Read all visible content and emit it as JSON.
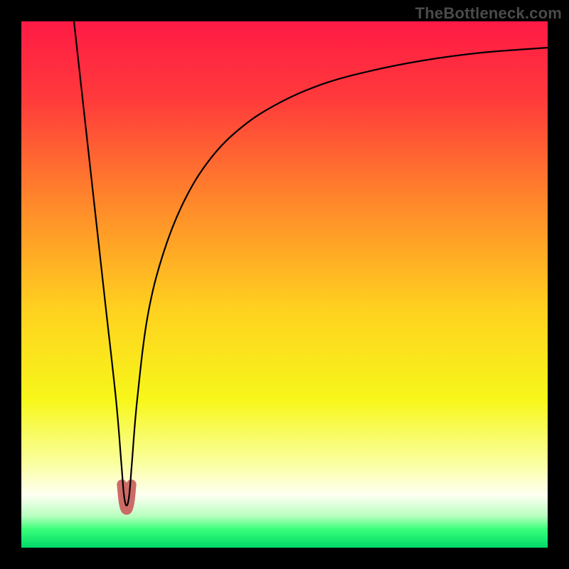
{
  "watermark": "TheBottleneck.com",
  "chart_data": {
    "type": "line",
    "title": "",
    "xlabel": "",
    "ylabel": "",
    "xlim": [
      0,
      100
    ],
    "ylim": [
      0,
      100
    ],
    "grid": false,
    "legend": false,
    "gradient_stops": [
      {
        "offset": 0.0,
        "color": "#ff1a45"
      },
      {
        "offset": 0.15,
        "color": "#ff3b3b"
      },
      {
        "offset": 0.35,
        "color": "#ff8a2a"
      },
      {
        "offset": 0.55,
        "color": "#ffd21f"
      },
      {
        "offset": 0.72,
        "color": "#f7f71a"
      },
      {
        "offset": 0.84,
        "color": "#faffa0"
      },
      {
        "offset": 0.9,
        "color": "#fefff2"
      },
      {
        "offset": 0.94,
        "color": "#b8ffc0"
      },
      {
        "offset": 0.965,
        "color": "#3aff7a"
      },
      {
        "offset": 1.0,
        "color": "#00d968"
      }
    ],
    "series": [
      {
        "name": "bottleneck-curve",
        "color": "#000000",
        "x": [
          10,
          12,
          14,
          16,
          18,
          19,
          19.5,
          20,
          20.5,
          21,
          22,
          24,
          27,
          31,
          36,
          42,
          49,
          57,
          66,
          76,
          87,
          100
        ],
        "y": [
          100,
          82,
          64,
          46,
          28,
          16,
          10,
          8,
          10,
          16,
          28,
          44,
          56,
          66,
          74,
          80,
          84.5,
          88,
          90.5,
          92.5,
          94,
          95
        ]
      }
    ],
    "marker": {
      "name": "dip-marker",
      "color": "#cc6b66",
      "x": [
        19.1,
        19.4,
        19.7,
        20.0,
        20.3,
        20.6,
        20.9
      ],
      "y": [
        12.0,
        9.0,
        7.6,
        7.2,
        7.6,
        9.0,
        12.0
      ],
      "stroke_width_px": 14
    }
  }
}
